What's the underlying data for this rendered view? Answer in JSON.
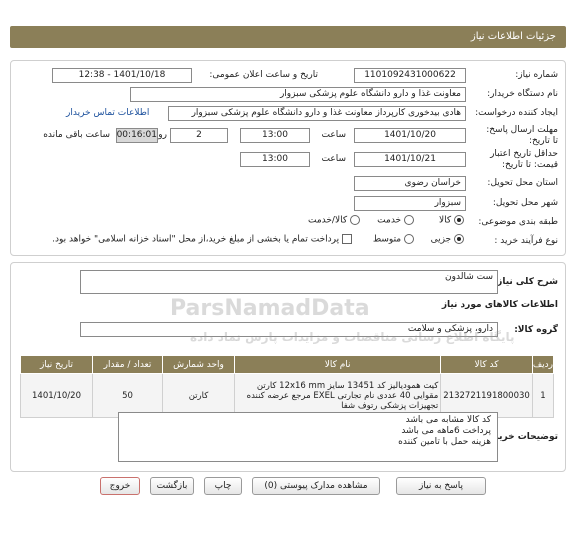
{
  "header": {
    "title": "جزئیات اطلاعات نیاز"
  },
  "info": {
    "need_number_label": "شماره نیاز:",
    "need_number": "1101092431000622",
    "announce_label": "تاریخ و ساعت اعلان عمومی:",
    "announce_value": "1401/10/18 - 12:38",
    "buyer_org_label": "نام دستگاه خریدار:",
    "buyer_org": "معاونت غذا و دارو   دانشگاه علوم پزشکی سبزوار",
    "creator_label": "ایجاد کننده درخواست:",
    "creator": "هادی بیدخوری کارپرداز معاونت غذا و دارو   دانشگاه علوم پزشکی سبزوار",
    "contact_link": "اطلاعات تماس خریدار",
    "deadline_label": "مهلت ارسال پاسخ: تا تاریخ:",
    "deadline_date": "1401/10/20",
    "time_label": "ساعت",
    "deadline_time": "13:00",
    "days_value": "2",
    "days_label": "روز و",
    "remaining_time": "00:16:01",
    "remaining_label": "ساعت باقی مانده",
    "validity_label": "حداقل تاریخ اعتبار قیمت: تا تاریخ:",
    "validity_date": "1401/10/21",
    "validity_time": "13:00",
    "province_label": "استان محل تحویل:",
    "province": "خراسان رضوی",
    "city_label": "شهر محل تحویل:",
    "city": "سبزوار",
    "category_label": "طبقه بندی موضوعی:",
    "category_options": [
      "کالا",
      "خدمت",
      "کالا/خدمت"
    ],
    "process_label": "نوع فرآیند خرید :",
    "process_options": [
      "جزیی",
      "متوسط"
    ],
    "payment_note": "پرداخت تمام یا بخشی از مبلغ خرید،از محل \"اسناد خزانه اسلامی\" خواهد بود."
  },
  "summary": {
    "label": "شرح کلی نیاز:",
    "value": "ست شالدون"
  },
  "goods": {
    "section_title": "اطلاعات کالاهای مورد نیاز",
    "group_label": "گروه کالا:",
    "group_value": "دارو، پزشکی و سلامت",
    "columns": [
      "ردیف",
      "کد کالا",
      "نام کالا",
      "واحد شمارش",
      "تعداد / مقدار",
      "تاریخ نیاز"
    ],
    "rows": [
      {
        "index": "1",
        "code": "2132721191800030",
        "name": "کیت همودیالیز کد 13451 سایز 12x16 mm کارتن مقوایی 40 عددی نام تجارتی EXEL مرجع عرضه کننده تجهیزات پزشکی رتوف شفا",
        "unit": "کارتن",
        "qty": "50",
        "date": "1401/10/20"
      }
    ]
  },
  "buyer_notes": {
    "label": "توضیحات خریدار:",
    "lines": [
      "کد کالا مشابه می باشد",
      "پرداخت 6ماهه می باشد",
      "هزینه حمل با تامین کننده"
    ]
  },
  "buttons": {
    "reply": "پاسخ به نیاز",
    "view_docs": "مشاهده مدارک پیوستی (0)",
    "print": "چاپ",
    "back": "بازگشت",
    "exit": "خروج"
  },
  "watermark": {
    "text": "ParsNamadData",
    "subtext": "پایگاه اطلاع رسانی مناقصات و مزایدات پارس نماد داده"
  },
  "colors": {
    "header": "#8b7f58",
    "link": "#1a4f9c",
    "exit_border": "#c9716d"
  }
}
